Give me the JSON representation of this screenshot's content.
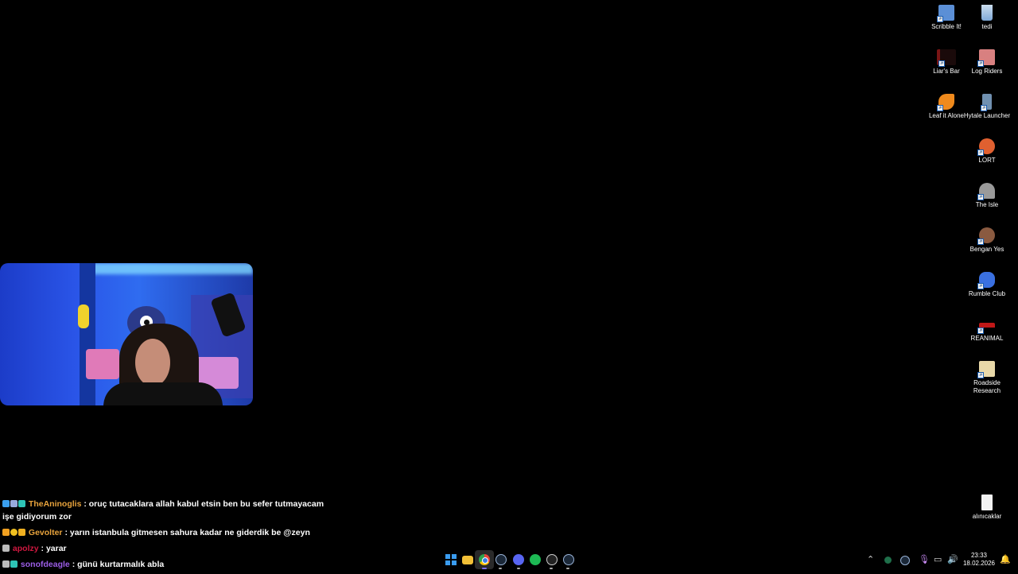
{
  "desktop_icons": [
    {
      "label": "Scribble It!",
      "icon": "scribble-it-icon",
      "color": "#5b8fd6"
    },
    {
      "label": "tedi",
      "icon": "recycle-bin-icon",
      "color": "#7fa9d8"
    },
    {
      "label": "Liar's Bar",
      "icon": "liars-bar-icon",
      "color": "#7a1515"
    },
    {
      "label": "Log Riders",
      "icon": "log-riders-icon",
      "color": "#d88080"
    },
    {
      "label": "Leaf it Alone",
      "icon": "leaf-it-alone-icon",
      "color": "#f08a1c"
    },
    {
      "label": "Hytale Launcher",
      "icon": "hytale-launcher-icon",
      "color": "#7090b0"
    },
    {
      "label": "LORT",
      "icon": "lort-icon",
      "color": "#e06030"
    },
    {
      "label": "The Isle",
      "icon": "the-isle-icon",
      "color": "#9a9a9a"
    },
    {
      "label": "Bengan Yes",
      "icon": "bengan-yes-icon",
      "color": "#8a5a40"
    },
    {
      "label": "Rumble Club",
      "icon": "rumble-club-icon",
      "color": "#3a70e0"
    },
    {
      "label": "REANIMAL",
      "icon": "reanimal-icon",
      "color": "#c01818"
    },
    {
      "label": "Roadside Research",
      "icon": "roadside-research-icon",
      "color": "#e8d8a8"
    },
    {
      "label": "alınıcaklar",
      "icon": "text-file-icon",
      "color": "#f2f2f2"
    }
  ],
  "chat": [
    {
      "badges": [
        "#3aa0f0",
        "#9ad",
        "#2ec4b6"
      ],
      "user": "TheAninoglis",
      "user_color": "#e8a33c",
      "text": ": oruç tutacaklara allah kabul etsin ben bu sefer tutmayacam",
      "text2": "işe gidiyorum zor"
    },
    {
      "badges": [
        "#f0a020",
        "#f0c020",
        "#f0b020"
      ],
      "user": "Gevolter",
      "user_color": "#e8a33c",
      "text": ": yarın istanbula gitmesen sahura kadar ne giderdik be @zeyn",
      "text2": ""
    },
    {
      "badges": [
        "#bbb"
      ],
      "user": "apolzy",
      "user_color": "#d01840",
      "text": ": yarar",
      "text2": ""
    },
    {
      "badges": [
        "#bbb",
        "#2ec4b6"
      ],
      "user": "sonofdeagle",
      "user_color": "#9b5de5",
      "text": ": günü kurtarmalık abla",
      "text2": ""
    }
  ],
  "taskbar": {
    "apps": [
      {
        "name": "windows-start-icon",
        "color": "#3a9cf0"
      },
      {
        "name": "file-explorer-icon",
        "color": "#f2c037"
      },
      {
        "name": "chrome-icon",
        "color": "#e8453c"
      },
      {
        "name": "steam-icon",
        "color": "#9ab4d8"
      },
      {
        "name": "discord-icon",
        "color": "#5865f2"
      },
      {
        "name": "spotify-icon",
        "color": "#1db954"
      },
      {
        "name": "obs-icon",
        "color": "#cfcfcf"
      },
      {
        "name": "steam-alt-icon",
        "color": "#9ab4d8"
      }
    ],
    "tray_icons": [
      "chevron-up-icon",
      "nvidia-icon",
      "steam-tray-icon",
      "microphone-icon",
      "network-icon",
      "volume-icon"
    ],
    "time": "23:33",
    "date": "18.02.2026"
  }
}
